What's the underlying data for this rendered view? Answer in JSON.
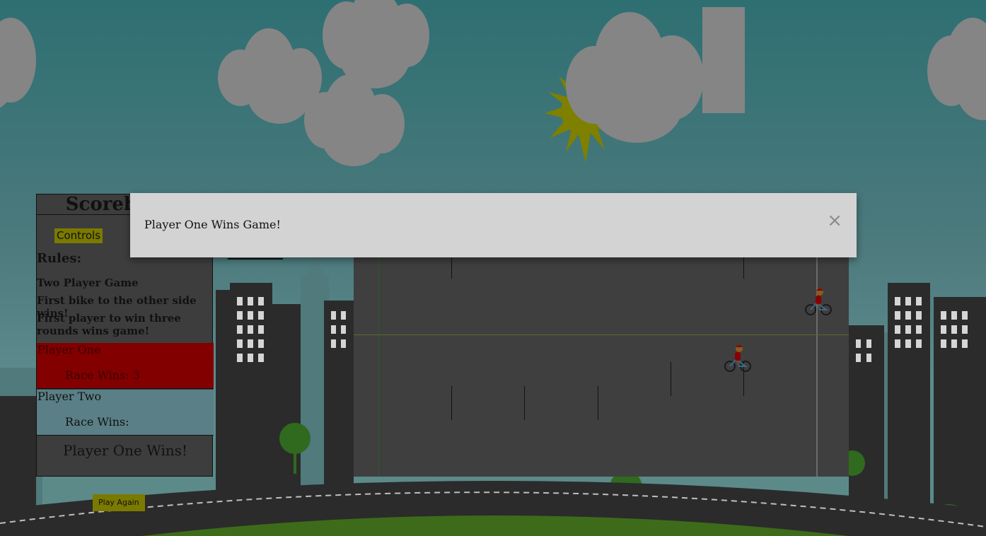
{
  "scoreboard": {
    "title": "Scoreboard",
    "controls_label": "Controls",
    "rules_heading": "Rules:",
    "rules": [
      "Two Player Game",
      "First bike to the other side wins!",
      "First player to win three rounds wins game!"
    ],
    "player_one": {
      "name": "Player One",
      "race_wins_label": "Race Wins: 3"
    },
    "player_two": {
      "name": "Player Two",
      "race_wins_label": "Race Wins:"
    },
    "winner_text": "Player One Wins!"
  },
  "play_again_label": "Play Again",
  "modal": {
    "message": "Player One Wins Game!",
    "close_symbol": "×"
  },
  "colors": {
    "player_one_bg": "#820000",
    "player_two_bg": "#5a7f86",
    "button_bg": "#7a7a00",
    "sun": "#7f7f00",
    "cloud": "#858585",
    "track": "#3f3f3f",
    "modal_bg": "#d3d3d3"
  },
  "icons": {
    "player_one_bike": "cyclist-icon",
    "player_two_bike": "cyclist-icon",
    "close": "close-icon",
    "sun": "sun-icon"
  }
}
